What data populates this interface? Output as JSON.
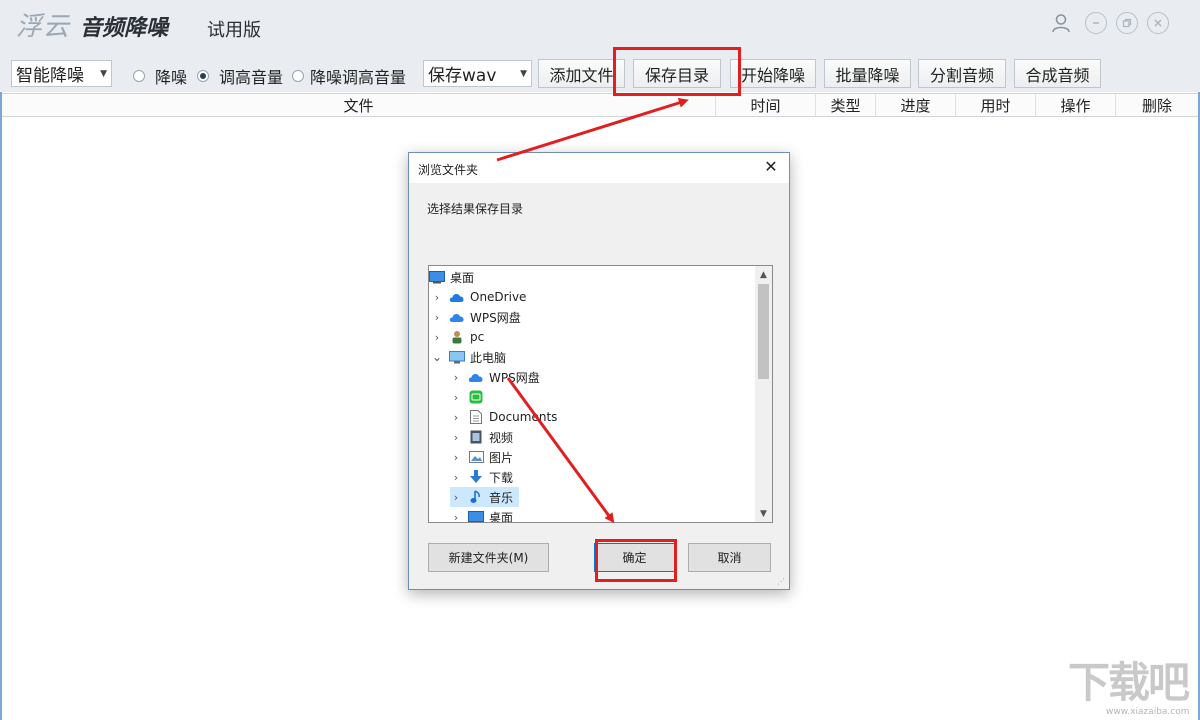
{
  "app": {
    "brand": "浮云",
    "product": "音频降噪",
    "edition": "试用版",
    "window_icons": [
      "user-icon",
      "minimize-icon",
      "restore-icon",
      "close-icon"
    ]
  },
  "toolbar": {
    "mode_select": "智能降噪",
    "radios": [
      {
        "label": "降噪",
        "checked": false
      },
      {
        "label": "调高音量",
        "checked": true
      },
      {
        "label": "降噪调高音量",
        "checked": false
      }
    ],
    "format_select": "保存wav",
    "buttons": {
      "add_files": "添加文件",
      "save_dir": "保存目录",
      "start": "开始降噪",
      "batch": "批量降噪",
      "split": "分割音频",
      "merge": "合成音频"
    }
  },
  "table": {
    "columns": [
      "文件",
      "时间",
      "类型",
      "进度",
      "用时",
      "操作",
      "删除"
    ]
  },
  "dialog": {
    "title": "浏览文件夹",
    "prompt": "选择结果保存目录",
    "tree": [
      {
        "label": "桌面",
        "icon": "desktop-icon",
        "chevron": ""
      },
      {
        "label": "OneDrive",
        "icon": "cloud-icon",
        "chevron": "›"
      },
      {
        "label": "WPS网盘",
        "icon": "cloud-icon",
        "chevron": "›"
      },
      {
        "label": "pc",
        "icon": "user-icon",
        "chevron": "›"
      },
      {
        "label": "此电脑",
        "icon": "computer-icon",
        "chevron": "⌄"
      },
      {
        "label": "WPS网盘",
        "icon": "cloud-icon",
        "chevron": "›"
      },
      {
        "label": "",
        "icon": "app-icon",
        "chevron": "›"
      },
      {
        "label": "Documents",
        "icon": "document-icon",
        "chevron": "›"
      },
      {
        "label": "视频",
        "icon": "video-icon",
        "chevron": "›"
      },
      {
        "label": "图片",
        "icon": "picture-icon",
        "chevron": "›"
      },
      {
        "label": "下载",
        "icon": "download-icon",
        "chevron": "›"
      },
      {
        "label": "音乐",
        "icon": "music-icon",
        "chevron": "›"
      },
      {
        "label": "桌面",
        "icon": "desktop-icon",
        "chevron": "›"
      }
    ],
    "selected_item": "音乐",
    "new_folder_button": "新建文件夹(M)",
    "ok_button": "确定",
    "cancel_button": "取消"
  },
  "watermark": {
    "logo_text": "下载吧",
    "url": "www.xiazaiba.com"
  },
  "colors": {
    "titlebar_bg": "#e9edf1",
    "annotation_red": "#e02020",
    "selection_blue": "#cce8ff"
  }
}
